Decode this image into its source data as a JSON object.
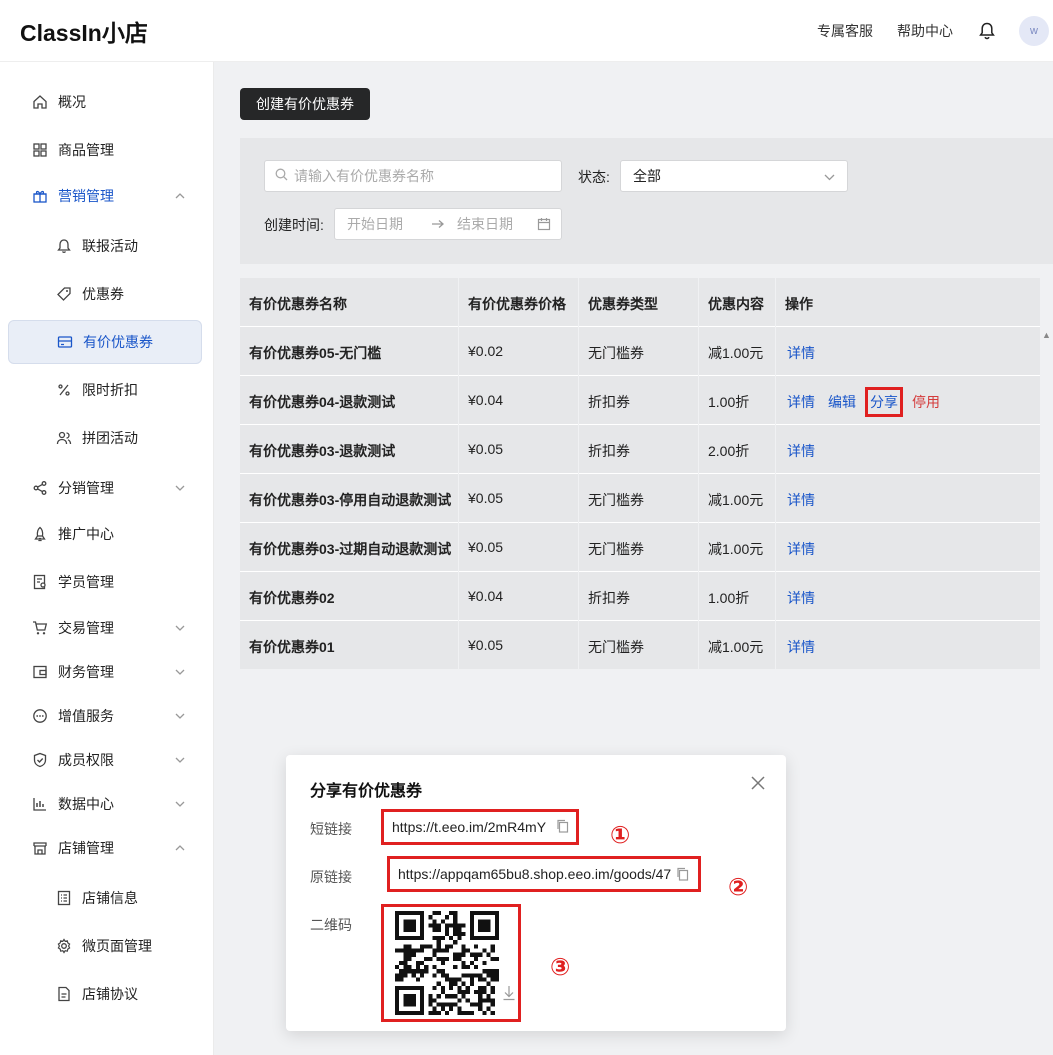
{
  "header": {
    "logo": "ClassIn小店",
    "links": [
      "专属客服",
      "帮助中心"
    ],
    "avatar_initial": "w"
  },
  "sidebar": {
    "items": [
      {
        "label": "概况",
        "icon": "home-icon"
      },
      {
        "label": "商品管理",
        "icon": "grid-icon"
      },
      {
        "label": "营销管理",
        "icon": "gift-icon",
        "expanded": true
      },
      {
        "label": "联报活动",
        "icon": "bell-icon",
        "sub": true
      },
      {
        "label": "优惠券",
        "icon": "tag-icon",
        "sub": true
      },
      {
        "label": "有价优惠券",
        "icon": "card-icon",
        "sub": true,
        "active": true
      },
      {
        "label": "限时折扣",
        "icon": "percent-icon",
        "sub": true
      },
      {
        "label": "拼团活动",
        "icon": "users-icon",
        "sub": true
      },
      {
        "label": "分销管理",
        "icon": "share-icon"
      },
      {
        "label": "推广中心",
        "icon": "rocket-icon"
      },
      {
        "label": "学员管理",
        "icon": "student-icon"
      },
      {
        "label": "交易管理",
        "icon": "cart-icon"
      },
      {
        "label": "财务管理",
        "icon": "wallet-icon"
      },
      {
        "label": "增值服务",
        "icon": "chat-icon"
      },
      {
        "label": "成员权限",
        "icon": "shield-icon"
      },
      {
        "label": "数据中心",
        "icon": "bar-chart-icon"
      },
      {
        "label": "店铺管理",
        "icon": "store-icon",
        "expanded": true
      },
      {
        "label": "店铺信息",
        "icon": "list-icon",
        "sub": true
      },
      {
        "label": "微页面管理",
        "icon": "gear-icon",
        "sub": true
      },
      {
        "label": "店铺协议",
        "icon": "document-icon",
        "sub": true
      }
    ]
  },
  "main": {
    "create_button": "创建有价优惠券",
    "search_placeholder": "请输入有价优惠券名称",
    "status_label": "状态:",
    "status_value": "全部",
    "date_label": "创建时间:",
    "date_start_placeholder": "开始日期",
    "date_end_placeholder": "结束日期"
  },
  "table": {
    "headers": [
      "有价优惠券名称",
      "有价优惠券价格",
      "优惠券类型",
      "优惠内容",
      "操作"
    ],
    "rows": [
      {
        "name": "有价优惠券05-无门槛",
        "price": "¥0.02",
        "type": "无门槛券",
        "content": "减1.00元",
        "actions": [
          "详情"
        ]
      },
      {
        "name": "有价优惠券04-退款测试",
        "price": "¥0.04",
        "type": "折扣券",
        "content": "1.00折",
        "actions": [
          "详情",
          "编辑",
          "分享",
          "停用"
        ]
      },
      {
        "name": "有价优惠券03-退款测试",
        "price": "¥0.05",
        "type": "折扣券",
        "content": "2.00折",
        "actions": [
          "详情"
        ]
      },
      {
        "name": "有价优惠券03-停用自动退款测试",
        "price": "¥0.05",
        "type": "无门槛券",
        "content": "减1.00元",
        "actions": [
          "详情"
        ]
      },
      {
        "name": "有价优惠券03-过期自动退款测试",
        "price": "¥0.05",
        "type": "无门槛券",
        "content": "减1.00元",
        "actions": [
          "详情"
        ]
      },
      {
        "name": "有价优惠券02",
        "price": "¥0.04",
        "type": "折扣券",
        "content": "1.00折",
        "actions": [
          "详情"
        ]
      },
      {
        "name": "有价优惠券01",
        "price": "¥0.05",
        "type": "无门槛券",
        "content": "减1.00元",
        "actions": [
          "详情"
        ]
      }
    ]
  },
  "modal": {
    "title": "分享有价优惠券",
    "short_link_label": "短链接",
    "short_link": "https://t.eeo.im/2mR4mY",
    "full_link_label": "原链接",
    "full_link": "https://appqam65bu8.shop.eeo.im/goods/47",
    "qr_label": "二维码",
    "markers": [
      "①",
      "②",
      "③"
    ]
  },
  "colors": {
    "accent": "#1a56c9",
    "danger": "#d43b3b",
    "highlight": "#e02020",
    "dark_button": "#262728"
  }
}
